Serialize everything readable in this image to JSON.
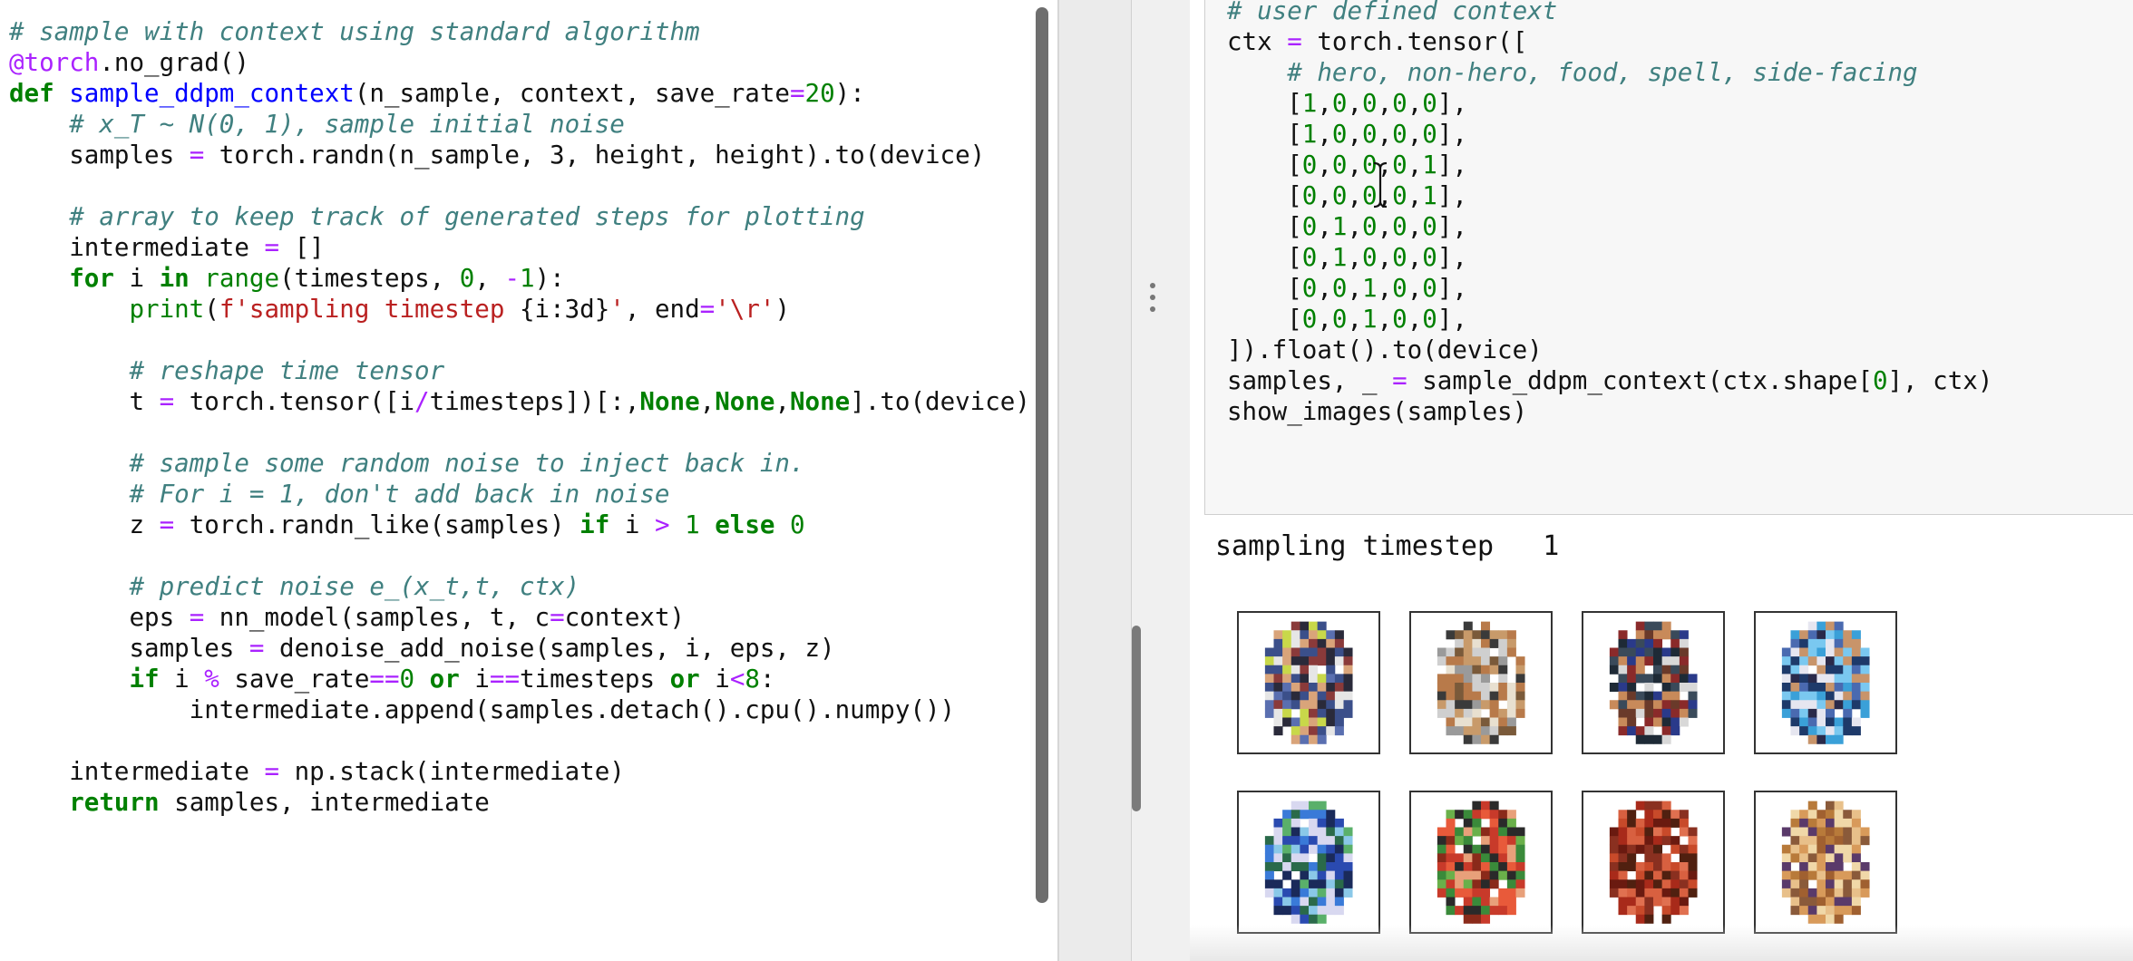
{
  "left_cell": {
    "lines": [
      [
        {
          "t": "# sample with context using standard algorithm",
          "c": "cm"
        }
      ],
      [
        {
          "t": "@torch",
          "c": "dec"
        },
        {
          "t": ".no_grad()",
          "c": ""
        }
      ],
      [
        {
          "t": "def ",
          "c": "kw"
        },
        {
          "t": "sample_ddpm_context",
          "c": "fn"
        },
        {
          "t": "(n_sample, context, save_rate",
          "c": ""
        },
        {
          "t": "=",
          "c": "op"
        },
        {
          "t": "20",
          "c": "num"
        },
        {
          "t": "):",
          "c": ""
        }
      ],
      [
        {
          "t": "    ",
          "c": ""
        },
        {
          "t": "# x_T ~ N(0, 1), sample initial noise",
          "c": "cm"
        }
      ],
      [
        {
          "t": "    samples ",
          "c": ""
        },
        {
          "t": "=",
          "c": "op"
        },
        {
          "t": " torch.randn(n_sample, 3, height, height).to(device)",
          "c": ""
        }
      ],
      [
        {
          "t": "",
          "c": ""
        }
      ],
      [
        {
          "t": "    ",
          "c": ""
        },
        {
          "t": "# array to keep track of generated steps for plotting",
          "c": "cm"
        }
      ],
      [
        {
          "t": "    intermediate ",
          "c": ""
        },
        {
          "t": "=",
          "c": "op"
        },
        {
          "t": " []",
          "c": ""
        }
      ],
      [
        {
          "t": "    ",
          "c": ""
        },
        {
          "t": "for",
          "c": "kw"
        },
        {
          "t": " i ",
          "c": ""
        },
        {
          "t": "in",
          "c": "kw"
        },
        {
          "t": " ",
          "c": ""
        },
        {
          "t": "range",
          "c": "bi"
        },
        {
          "t": "(timesteps, ",
          "c": ""
        },
        {
          "t": "0",
          "c": "num"
        },
        {
          "t": ", ",
          "c": ""
        },
        {
          "t": "-",
          "c": "op"
        },
        {
          "t": "1",
          "c": "num"
        },
        {
          "t": "):",
          "c": ""
        }
      ],
      [
        {
          "t": "        ",
          "c": ""
        },
        {
          "t": "print",
          "c": "bi"
        },
        {
          "t": "(",
          "c": ""
        },
        {
          "t": "f'sampling timestep ",
          "c": "str"
        },
        {
          "t": "{i:3d}",
          "c": ""
        },
        {
          "t": "'",
          "c": "str"
        },
        {
          "t": ", end",
          "c": ""
        },
        {
          "t": "=",
          "c": "op"
        },
        {
          "t": "'\\r'",
          "c": "str"
        },
        {
          "t": ")",
          "c": ""
        }
      ],
      [
        {
          "t": "",
          "c": ""
        }
      ],
      [
        {
          "t": "        ",
          "c": ""
        },
        {
          "t": "# reshape time tensor",
          "c": "cm"
        }
      ],
      [
        {
          "t": "        t ",
          "c": ""
        },
        {
          "t": "=",
          "c": "op"
        },
        {
          "t": " torch.tensor([i",
          "c": ""
        },
        {
          "t": "/",
          "c": "op"
        },
        {
          "t": "timesteps])[:,",
          "c": ""
        },
        {
          "t": "None",
          "c": "kw"
        },
        {
          "t": ",",
          "c": ""
        },
        {
          "t": "None",
          "c": "kw"
        },
        {
          "t": ",",
          "c": ""
        },
        {
          "t": "None",
          "c": "kw"
        },
        {
          "t": "].to(device)",
          "c": ""
        }
      ],
      [
        {
          "t": "",
          "c": ""
        }
      ],
      [
        {
          "t": "        ",
          "c": ""
        },
        {
          "t": "# sample some random noise to inject back in.",
          "c": "cm"
        }
      ],
      [
        {
          "t": "        ",
          "c": ""
        },
        {
          "t": "# For i = 1, don't add back in noise",
          "c": "cm"
        }
      ],
      [
        {
          "t": "        z ",
          "c": ""
        },
        {
          "t": "=",
          "c": "op"
        },
        {
          "t": " torch.randn_like(samples) ",
          "c": ""
        },
        {
          "t": "if",
          "c": "kw"
        },
        {
          "t": " i ",
          "c": ""
        },
        {
          "t": ">",
          "c": "op"
        },
        {
          "t": " ",
          "c": ""
        },
        {
          "t": "1",
          "c": "num"
        },
        {
          "t": " ",
          "c": ""
        },
        {
          "t": "else",
          "c": "kw"
        },
        {
          "t": " ",
          "c": ""
        },
        {
          "t": "0",
          "c": "num"
        }
      ],
      [
        {
          "t": "",
          "c": ""
        }
      ],
      [
        {
          "t": "        ",
          "c": ""
        },
        {
          "t": "# predict noise e_(x_t,t, ctx)",
          "c": "cm"
        }
      ],
      [
        {
          "t": "        eps ",
          "c": ""
        },
        {
          "t": "=",
          "c": "op"
        },
        {
          "t": " nn_model(samples, t, c",
          "c": ""
        },
        {
          "t": "=",
          "c": "op"
        },
        {
          "t": "context)",
          "c": ""
        }
      ],
      [
        {
          "t": "        samples ",
          "c": ""
        },
        {
          "t": "=",
          "c": "op"
        },
        {
          "t": " denoise_add_noise(samples, i, eps, z)",
          "c": ""
        }
      ],
      [
        {
          "t": "        ",
          "c": ""
        },
        {
          "t": "if",
          "c": "kw"
        },
        {
          "t": " i ",
          "c": ""
        },
        {
          "t": "%",
          "c": "op"
        },
        {
          "t": " save_rate",
          "c": ""
        },
        {
          "t": "==",
          "c": "op"
        },
        {
          "t": "0",
          "c": "num"
        },
        {
          "t": " ",
          "c": ""
        },
        {
          "t": "or",
          "c": "kw"
        },
        {
          "t": " i",
          "c": ""
        },
        {
          "t": "==",
          "c": "op"
        },
        {
          "t": "timesteps ",
          "c": ""
        },
        {
          "t": "or",
          "c": "kw"
        },
        {
          "t": " i",
          "c": ""
        },
        {
          "t": "<",
          "c": "op"
        },
        {
          "t": "8",
          "c": "num"
        },
        {
          "t": ":",
          "c": ""
        }
      ],
      [
        {
          "t": "            intermediate.append(samples.detach().cpu().numpy())",
          "c": ""
        }
      ],
      [
        {
          "t": "",
          "c": ""
        }
      ],
      [
        {
          "t": "    intermediate ",
          "c": ""
        },
        {
          "t": "=",
          "c": "op"
        },
        {
          "t": " np.stack(intermediate)",
          "c": ""
        }
      ],
      [
        {
          "t": "    ",
          "c": ""
        },
        {
          "t": "return",
          "c": "kw"
        },
        {
          "t": " samples, intermediate",
          "c": ""
        }
      ]
    ]
  },
  "right_cell": {
    "lines": [
      [
        {
          "t": "# user defined context",
          "c": "cm"
        }
      ],
      [
        {
          "t": "ctx ",
          "c": ""
        },
        {
          "t": "=",
          "c": "op"
        },
        {
          "t": " torch.tensor([",
          "c": ""
        }
      ],
      [
        {
          "t": "    ",
          "c": ""
        },
        {
          "t": "# hero, non-hero, food, spell, side-facing",
          "c": "cm"
        }
      ],
      [
        {
          "t": "    [",
          "c": ""
        },
        {
          "t": "1",
          "c": "num"
        },
        {
          "t": ",",
          "c": ""
        },
        {
          "t": "0",
          "c": "num"
        },
        {
          "t": ",",
          "c": ""
        },
        {
          "t": "0",
          "c": "num"
        },
        {
          "t": ",",
          "c": ""
        },
        {
          "t": "0",
          "c": "num"
        },
        {
          "t": ",",
          "c": ""
        },
        {
          "t": "0",
          "c": "num"
        },
        {
          "t": "],",
          "c": ""
        }
      ],
      [
        {
          "t": "    [",
          "c": ""
        },
        {
          "t": "1",
          "c": "num"
        },
        {
          "t": ",",
          "c": ""
        },
        {
          "t": "0",
          "c": "num"
        },
        {
          "t": ",",
          "c": ""
        },
        {
          "t": "0",
          "c": "num"
        },
        {
          "t": ",",
          "c": ""
        },
        {
          "t": "0",
          "c": "num"
        },
        {
          "t": ",",
          "c": ""
        },
        {
          "t": "0",
          "c": "num"
        },
        {
          "t": "],",
          "c": ""
        }
      ],
      [
        {
          "t": "    [",
          "c": ""
        },
        {
          "t": "0",
          "c": "num"
        },
        {
          "t": ",",
          "c": ""
        },
        {
          "t": "0",
          "c": "num"
        },
        {
          "t": ",",
          "c": ""
        },
        {
          "t": "0",
          "c": "num"
        },
        {
          "t": ",",
          "c": ""
        },
        {
          "t": "0",
          "c": "num"
        },
        {
          "t": ",",
          "c": ""
        },
        {
          "t": "1",
          "c": "num"
        },
        {
          "t": "],",
          "c": ""
        }
      ],
      [
        {
          "t": "    [",
          "c": ""
        },
        {
          "t": "0",
          "c": "num"
        },
        {
          "t": ",",
          "c": ""
        },
        {
          "t": "0",
          "c": "num"
        },
        {
          "t": ",",
          "c": ""
        },
        {
          "t": "0",
          "c": "num"
        },
        {
          "t": ",",
          "c": ""
        },
        {
          "t": "0",
          "c": "num"
        },
        {
          "t": ",",
          "c": ""
        },
        {
          "t": "1",
          "c": "num"
        },
        {
          "t": "],",
          "c": ""
        }
      ],
      [
        {
          "t": "    [",
          "c": ""
        },
        {
          "t": "0",
          "c": "num"
        },
        {
          "t": ",",
          "c": ""
        },
        {
          "t": "1",
          "c": "num"
        },
        {
          "t": ",",
          "c": ""
        },
        {
          "t": "0",
          "c": "num"
        },
        {
          "t": ",",
          "c": ""
        },
        {
          "t": "0",
          "c": "num"
        },
        {
          "t": ",",
          "c": ""
        },
        {
          "t": "0",
          "c": "num"
        },
        {
          "t": "],",
          "c": ""
        }
      ],
      [
        {
          "t": "    [",
          "c": ""
        },
        {
          "t": "0",
          "c": "num"
        },
        {
          "t": ",",
          "c": ""
        },
        {
          "t": "1",
          "c": "num"
        },
        {
          "t": ",",
          "c": ""
        },
        {
          "t": "0",
          "c": "num"
        },
        {
          "t": ",",
          "c": ""
        },
        {
          "t": "0",
          "c": "num"
        },
        {
          "t": ",",
          "c": ""
        },
        {
          "t": "0",
          "c": "num"
        },
        {
          "t": "],",
          "c": ""
        }
      ],
      [
        {
          "t": "    [",
          "c": ""
        },
        {
          "t": "0",
          "c": "num"
        },
        {
          "t": ",",
          "c": ""
        },
        {
          "t": "0",
          "c": "num"
        },
        {
          "t": ",",
          "c": ""
        },
        {
          "t": "1",
          "c": "num"
        },
        {
          "t": ",",
          "c": ""
        },
        {
          "t": "0",
          "c": "num"
        },
        {
          "t": ",",
          "c": ""
        },
        {
          "t": "0",
          "c": "num"
        },
        {
          "t": "],",
          "c": ""
        }
      ],
      [
        {
          "t": "    [",
          "c": ""
        },
        {
          "t": "0",
          "c": "num"
        },
        {
          "t": ",",
          "c": ""
        },
        {
          "t": "0",
          "c": "num"
        },
        {
          "t": ",",
          "c": ""
        },
        {
          "t": "1",
          "c": "num"
        },
        {
          "t": ",",
          "c": ""
        },
        {
          "t": "0",
          "c": "num"
        },
        {
          "t": ",",
          "c": ""
        },
        {
          "t": "0",
          "c": "num"
        },
        {
          "t": "],",
          "c": ""
        }
      ],
      [
        {
          "t": "]).float().to(device)",
          "c": ""
        }
      ],
      [
        {
          "t": "samples, _ ",
          "c": ""
        },
        {
          "t": "=",
          "c": "op"
        },
        {
          "t": " sample_ddpm_context(ctx.shape[",
          "c": ""
        },
        {
          "t": "0",
          "c": "num"
        },
        {
          "t": "], ctx)",
          "c": ""
        }
      ],
      [
        {
          "t": "show_images(samples)",
          "c": ""
        }
      ]
    ]
  },
  "output": {
    "text": "sampling timestep   1"
  },
  "sprites": [
    {
      "icon": "hero-sprite-blue-hair",
      "bg": "#ffffff",
      "colors": [
        "#3b4f8a",
        "#5a6fb0",
        "#d9a47a",
        "#2a2a3a",
        "#8a3a3a",
        "#e6e6e6",
        "#c8d84a"
      ]
    },
    {
      "icon": "hero-sprite-white-hair",
      "bg": "#ffffff",
      "colors": [
        "#cfcfcf",
        "#9a9a9a",
        "#c89a6a",
        "#7a5a3a",
        "#3a3a3a",
        "#e8e0d0",
        "#b87a4a"
      ]
    },
    {
      "icon": "hero-sprite-dark-hair",
      "bg": "#ffffff",
      "colors": [
        "#1e2a36",
        "#3a4a5a",
        "#c88a5a",
        "#6a3a2a",
        "#d8d8d8",
        "#8a2a2a",
        "#2a3a8a"
      ]
    },
    {
      "icon": "hero-sprite-cyan-mage",
      "bg": "#ffffff",
      "colors": [
        "#3aa0d8",
        "#1e3a6a",
        "#c8946a",
        "#7ac8f0",
        "#2a2a4a",
        "#e6e6f0",
        "#4a6ab0"
      ]
    },
    {
      "icon": "nonhero-sprite-blue-creature",
      "bg": "#ffffff",
      "colors": [
        "#2a4ab0",
        "#3a7ad8",
        "#1a2a5a",
        "#5ab06a",
        "#8ac8e8",
        "#2a6a4a",
        "#d8d8f0"
      ]
    },
    {
      "icon": "nonhero-sprite-red-creature",
      "bg": "#ffffff",
      "colors": [
        "#c83a2a",
        "#e85a3a",
        "#3a8a3a",
        "#8a2a1a",
        "#e8a07a",
        "#2a2a2a",
        "#6ab04a"
      ]
    },
    {
      "icon": "food-sprite-red-fruit",
      "bg": "#ffffff",
      "colors": [
        "#a82a1a",
        "#c84a2a",
        "#6a1a10",
        "#e07050",
        "#8a3020",
        "#d86040",
        "#502010"
      ]
    },
    {
      "icon": "food-sprite-baked-item",
      "bg": "#ffffff",
      "colors": [
        "#d89a5a",
        "#b87a3a",
        "#5a3a6a",
        "#e8c08a",
        "#8a5a3a",
        "#f0d8a8",
        "#a06030"
      ]
    }
  ]
}
